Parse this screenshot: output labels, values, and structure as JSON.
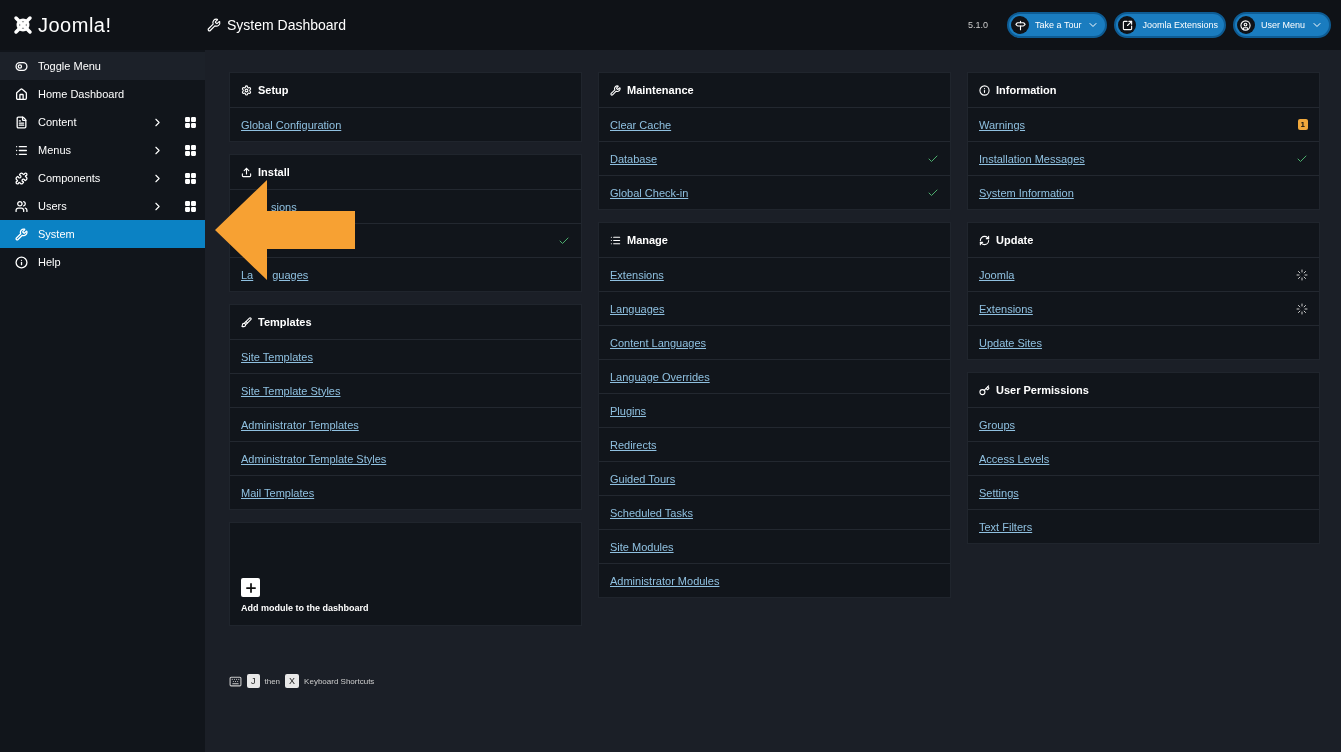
{
  "header": {
    "brand": "Joomla!",
    "title": "System Dashboard",
    "version": "5.1.0",
    "buttons": [
      {
        "label": "Take a Tour",
        "caret": true
      },
      {
        "label": "Joomla Extensions",
        "caret": false
      },
      {
        "label": "User Menu",
        "caret": true
      }
    ]
  },
  "sidebar": {
    "items": [
      {
        "label": "Toggle Menu",
        "kind": "toggle",
        "selected": false
      },
      {
        "label": "Home Dashboard",
        "kind": "plain",
        "selected": false
      },
      {
        "label": "Content",
        "kind": "group",
        "selected": false
      },
      {
        "label": "Menus",
        "kind": "group",
        "selected": false
      },
      {
        "label": "Components",
        "kind": "group",
        "selected": false
      },
      {
        "label": "Users",
        "kind": "group",
        "selected": false
      },
      {
        "label": "System",
        "kind": "plain",
        "selected": true
      },
      {
        "label": "Help",
        "kind": "plain",
        "selected": false
      }
    ]
  },
  "columns": [
    [
      {
        "title": "Setup",
        "links": [
          {
            "parts": [
              "Global Configuration"
            ],
            "kind": "plain"
          }
        ]
      },
      {
        "title": "Install",
        "links": [
          {
            "parts": [
              "sions"
            ],
            "kind": "covered"
          },
          {
            "kind": "checked"
          },
          {
            "parts": [
              "La",
              "guages"
            ],
            "kind": "covered"
          }
        ]
      },
      {
        "title": "Templates",
        "links": [
          {
            "parts": [
              "Site Templates"
            ],
            "kind": "plain"
          },
          {
            "parts": [
              "Site Template Styles"
            ],
            "kind": "plain"
          },
          {
            "parts": [
              "Administrator Templates"
            ],
            "kind": "plain"
          },
          {
            "parts": [
              "Administrator Template Styles"
            ],
            "kind": "plain"
          },
          {
            "parts": [
              "Mail Templates"
            ],
            "kind": "plain"
          }
        ]
      }
    ],
    [
      {
        "title": "Maintenance",
        "links": [
          {
            "parts": [
              "Clear Cache"
            ],
            "kind": "plain"
          },
          {
            "parts": [
              "Database"
            ],
            "kind": "checked"
          },
          {
            "parts": [
              "Global Check-in"
            ],
            "kind": "checked"
          }
        ]
      },
      {
        "title": "Manage",
        "links": [
          {
            "parts": [
              "Extensions"
            ],
            "kind": "plain"
          },
          {
            "parts": [
              "Languages"
            ],
            "kind": "plain"
          },
          {
            "parts": [
              "Content Languages"
            ],
            "kind": "plain"
          },
          {
            "parts": [
              "Language Overrides"
            ],
            "kind": "plain"
          },
          {
            "parts": [
              "Plugins"
            ],
            "kind": "plain"
          },
          {
            "parts": [
              "Redirects"
            ],
            "kind": "plain"
          },
          {
            "parts": [
              "Guided Tours"
            ],
            "kind": "plain"
          },
          {
            "parts": [
              "Scheduled Tasks"
            ],
            "kind": "plain"
          },
          {
            "parts": [
              "Site Modules"
            ],
            "kind": "plain"
          },
          {
            "parts": [
              "Administrator Modules"
            ],
            "kind": "plain"
          }
        ]
      }
    ],
    [
      {
        "title": "Information",
        "links": [
          {
            "parts": [
              "Warnings"
            ],
            "kind": "counted",
            "badge": "1"
          },
          {
            "parts": [
              "Installation Messages"
            ],
            "kind": "checked"
          },
          {
            "parts": [
              "System Information"
            ],
            "kind": "plain"
          }
        ]
      },
      {
        "title": "Update",
        "links": [
          {
            "parts": [
              "Joomla"
            ],
            "kind": "pending"
          },
          {
            "parts": [
              "Extensions"
            ],
            "kind": "pending"
          },
          {
            "parts": [
              "Update Sites"
            ],
            "kind": "plain"
          }
        ]
      },
      {
        "title": "User Permissions",
        "links": [
          {
            "parts": [
              "Groups"
            ],
            "kind": "plain"
          },
          {
            "parts": [
              "Access Levels"
            ],
            "kind": "plain"
          },
          {
            "parts": [
              "Settings"
            ],
            "kind": "plain"
          },
          {
            "parts": [
              "Text Filters"
            ],
            "kind": "plain"
          }
        ]
      }
    ]
  ],
  "add_module": {
    "label": "Add module to the dashboard"
  },
  "shortcuts": {
    "keys": [
      "J",
      "X"
    ],
    "joiner": "then",
    "label": "Keyboard Shortcuts"
  }
}
